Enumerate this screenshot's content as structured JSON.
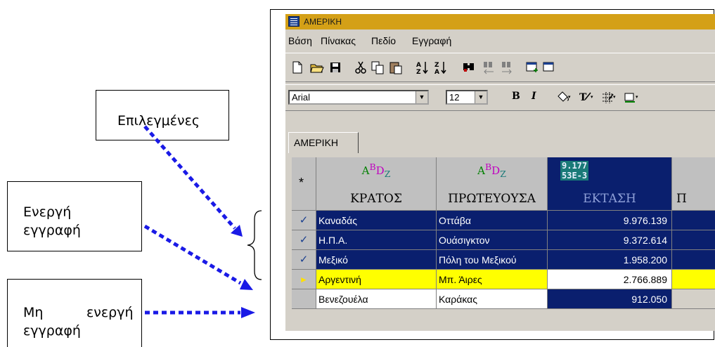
{
  "callouts": {
    "selected": "Επιλεγμένες",
    "active_line1": "Ενεργή",
    "active_line2": "εγγραφή",
    "inactive_line1a": "Μη",
    "inactive_line1b": "ενεργή",
    "inactive_line2": "εγγραφή"
  },
  "window": {
    "title": "ΑΜΕΡΙΚΗ"
  },
  "menu": [
    "Βάση",
    "Πίνακας",
    "Πεδίο",
    "Εγγραφή"
  ],
  "format": {
    "font": "Arial",
    "size": "12",
    "bold": "B",
    "italic": "I"
  },
  "tab": "ΑΜΕΡΙΚΗ",
  "grid": {
    "corner": "*",
    "text_icon": [
      "A",
      "B",
      "D",
      "Z"
    ],
    "number_icon": [
      "9.177",
      "53E-3"
    ],
    "columns": [
      "ΚΡΑΤΟΣ",
      "ΠΡΩΤΕΥΟΥΣΑ",
      "ΕΚΤΑΣΗ",
      "Π"
    ],
    "rows": [
      {
        "marker": "✓",
        "country": "Καναδάς",
        "capital": "Οττάβα",
        "area": "9.976.139",
        "state": "selected"
      },
      {
        "marker": "✓",
        "country": "Η.Π.Α.",
        "capital": "Ουάσιγκτον",
        "area": "9.372.614",
        "state": "selected"
      },
      {
        "marker": "✓",
        "country": "Μεξικό",
        "capital": "Πόλη του Μεξικού",
        "area": "1.958.200",
        "state": "selected"
      },
      {
        "marker": "►",
        "country": "Αργεντινή",
        "capital": "Μπ. Άιρες",
        "area": "2.766.889",
        "state": "active"
      },
      {
        "marker": "",
        "country": "Βενεζουέλα",
        "capital": "Καράκας",
        "area": "912.050",
        "state": "normal"
      }
    ]
  },
  "colors": {
    "selection": "#0a1f6e",
    "active_row": "#ffff00",
    "arrow": "#1a1ae6",
    "titlebar": "#d4a017"
  }
}
